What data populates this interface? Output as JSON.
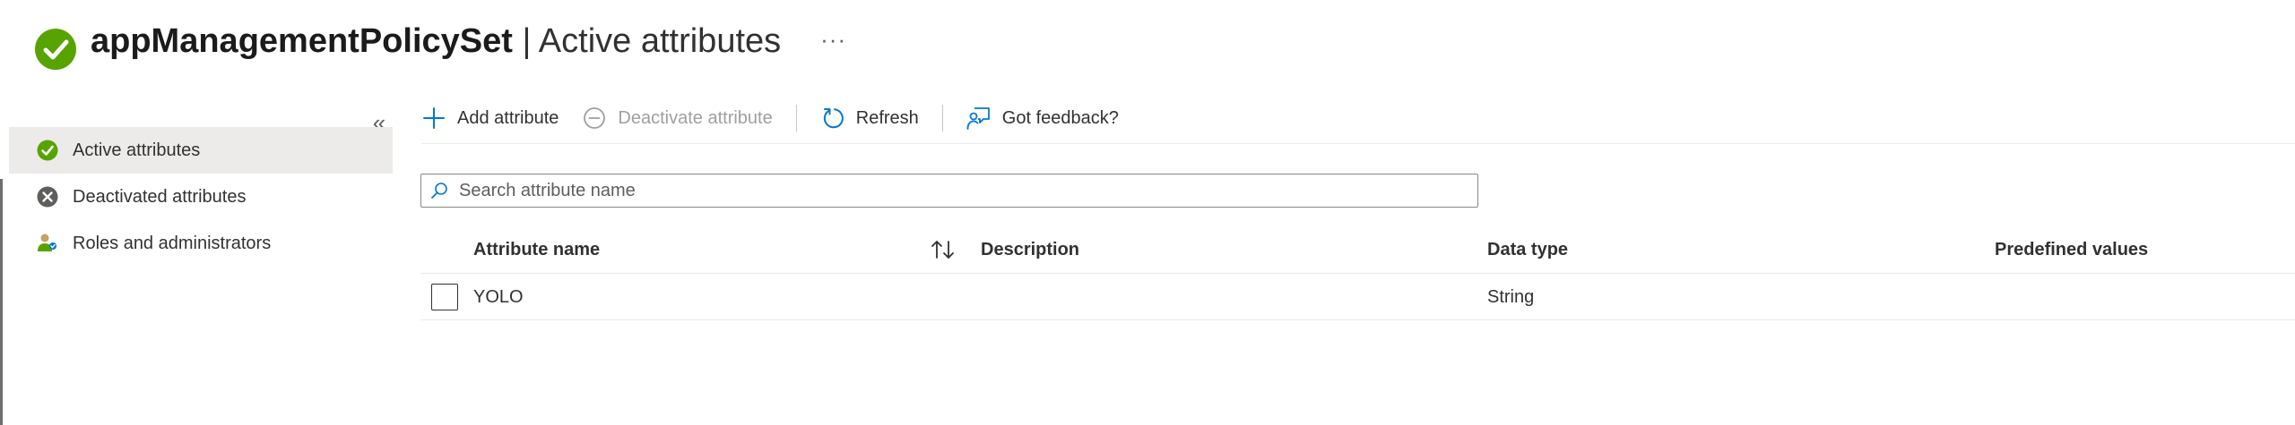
{
  "header": {
    "title_strong": "appManagementPolicySet",
    "title_rest": " | Active attributes",
    "more": "···",
    "status_icon": "check-circle-icon"
  },
  "sidebar": {
    "collapse": "«",
    "items": [
      {
        "label": "Active attributes",
        "icon": "check-circle-icon",
        "active": true
      },
      {
        "label": "Deactivated attributes",
        "icon": "x-circle-icon",
        "active": false
      },
      {
        "label": "Roles and administrators",
        "icon": "user-roles-icon",
        "active": false
      }
    ]
  },
  "toolbar": {
    "add": "Add attribute",
    "deactivate": "Deactivate attribute",
    "refresh": "Refresh",
    "feedback": "Got feedback?"
  },
  "search": {
    "placeholder": "Search attribute name",
    "value": ""
  },
  "table": {
    "columns": {
      "name": "Attribute name",
      "description": "Description",
      "data_type": "Data type",
      "predefined": "Predefined values"
    },
    "rows": [
      {
        "name": "YOLO",
        "description": "",
        "data_type": "String",
        "predefined": "",
        "checked": false
      }
    ]
  },
  "colors": {
    "accent": "#0078d4",
    "success": "#57a300",
    "neutral_icon": "#605e5c",
    "selected_nav": "#edebe9"
  }
}
